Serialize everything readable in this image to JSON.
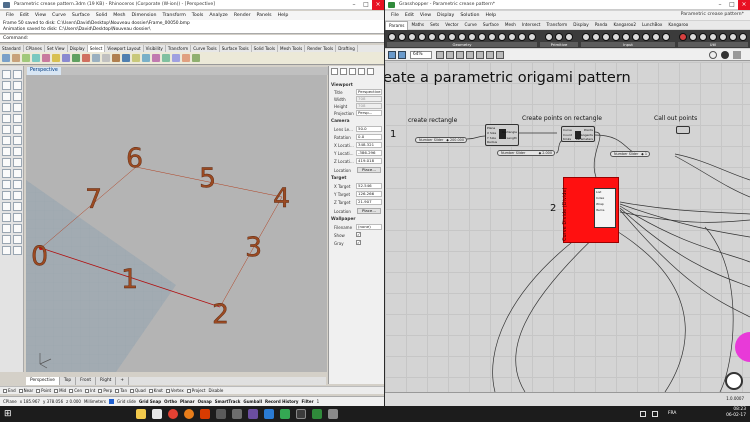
{
  "rhino": {
    "title": "Parametric crease pattern.3dm (19 KB) - Rhinoceros (Corporate (W-ion)) - [Perspective]",
    "menu": [
      "File",
      "Edit",
      "View",
      "Curve",
      "Surface",
      "Solid",
      "Mesh",
      "Dimension",
      "Transform",
      "Tools",
      "Analyze",
      "Render",
      "Panels",
      "Help"
    ],
    "history": [
      "Frame 50 saved to disk: C:\\Users\\David\\Desktop\\Nouveau dossier\\Frame_00050.bmp",
      "Animation saved to disk: C:\\Users\\David\\Desktop\\Nouveau dossier\\"
    ],
    "command_prompt": "Command:",
    "toolbar_tabs": [
      "Standard",
      "CPlanes",
      "Set View",
      "Display",
      "Select",
      "Viewport Layout",
      "Visibility",
      "Transform",
      "Curve Tools",
      "Surface Tools",
      "Solid Tools",
      "Mesh Tools",
      "Render Tools",
      "Drafting"
    ],
    "active_tab": "Select",
    "viewport_name": "Perspective",
    "point_labels": [
      "0",
      "1",
      "2",
      "3",
      "4",
      "5",
      "6",
      "7"
    ],
    "point_label_color": "#9b4a22",
    "properties": {
      "viewport_heading": "Viewport",
      "title_label": "Title",
      "title_value": "Perspective",
      "width_label": "Width",
      "width_value": "708",
      "height_label": "Height",
      "height_value": "708",
      "projection_label": "Projection",
      "projection_value": "Persp...",
      "camera_heading": "Camera",
      "lens_label": "Lens Le...",
      "lens_value": "50.0",
      "rotation_label": "Rotation",
      "rotation_value": "0.0",
      "xloc_label": "X Locati...",
      "xloc_value": "348.321",
      "yloc_label": "Y Locati...",
      "yloc_value": "-386.296",
      "zloc_label": "Z Locati...",
      "zloc_value": "419.018",
      "location_label": "Location",
      "place_button": "Place...",
      "target_heading": "Target",
      "xt_label": "X Target",
      "xt_value": "52.546",
      "yt_label": "Y Target",
      "yt_value": "126.266",
      "zt_label": "Z Target",
      "zt_value": "21.907",
      "tlocation_label": "Location",
      "tplace_button": "Place...",
      "wallpaper_heading": "Wallpaper",
      "filename_label": "Filename",
      "filename_value": "(none)",
      "show_label": "Show",
      "gray_label": "Gray",
      "check": "✓"
    },
    "viewport_tabs": [
      "Perspective",
      "Top",
      "Front",
      "Right",
      "+"
    ],
    "osnaps": [
      "End",
      "Near",
      "Point",
      "Mid",
      "Cen",
      "Int",
      "Perp",
      "Tan",
      "Quad",
      "Knot",
      "Vertex",
      "Project",
      "Disable"
    ],
    "status": {
      "cplane": "CPlane",
      "x": "x 185.967",
      "y": "y 378.056",
      "z": "z 0.000",
      "units": "Millimeters",
      "layer": "Grid slide",
      "buttons": [
        "Grid Snap",
        "Ortho",
        "Planar",
        "Osnap",
        "SmartTrack",
        "Gumball",
        "Record History",
        "Filter"
      ],
      "tail": "1"
    }
  },
  "grasshopper": {
    "title": "Grasshopper - Parametric crease pattern*",
    "doc_name": "Parametric crease pattern*",
    "menu": [
      "File",
      "Edit",
      "View",
      "Display",
      "Solution",
      "Help"
    ],
    "tabs": [
      "Params",
      "Maths",
      "Sets",
      "Vector",
      "Curve",
      "Surface",
      "Mesh",
      "Intersect",
      "Transform",
      "Display",
      "Panda",
      "Kangaroo2",
      "LunchBox",
      "Kangaroo"
    ],
    "active_tab": "Params",
    "ribbon_categories": [
      "Geometry",
      "Primitive",
      "Input",
      "Util"
    ],
    "zoom": "64%",
    "heading": "eate a parametric origami pattern",
    "groups": [
      {
        "label": "create rectangle",
        "num": "1"
      },
      {
        "label": "Create points on rectangle",
        "num": "2"
      },
      {
        "label": "Call out points",
        "num": ""
      }
    ],
    "rect_inputs": [
      "Plane",
      "X Size",
      "Y Size",
      "Radius"
    ],
    "rect_outputs": [
      "Rectangle",
      "Length"
    ],
    "slider_rect": "Number Slider",
    "slider_rect_val": "◆ 200.000",
    "slider_count": "Number Slider",
    "slider_count_val": "◆ 2.000",
    "slider_call": "Number Slider",
    "slider_call_val": "◆ 1",
    "points_inputs": [
      "Curve",
      "Count",
      "Kinks"
    ],
    "points_outputs": [
      "Points",
      "Tangents",
      "Parameters"
    ],
    "red_label": "Curve Divide (Divide)",
    "red_items": [
      "List",
      "Index",
      "Wrap",
      "Items"
    ],
    "status": "1.0.0007"
  },
  "taskbar": {
    "time": "08:23",
    "date": "06-02-17",
    "lang": "FRA"
  }
}
